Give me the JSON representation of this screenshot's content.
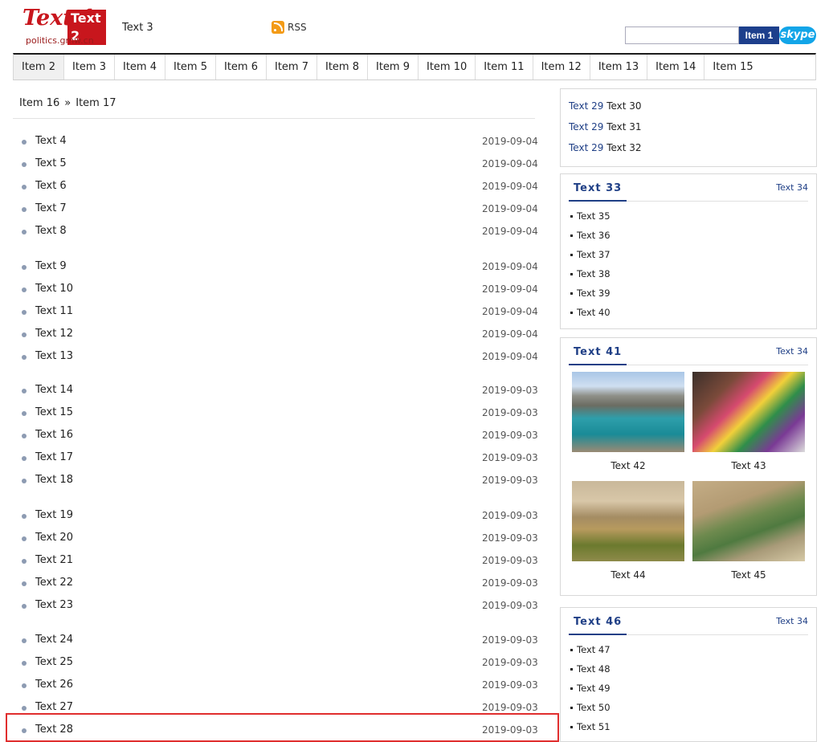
{
  "header": {
    "logo_script": "Text 1",
    "logo_badge": "Text 2",
    "logo_url": "politics.gmw.cn",
    "slogan": "Text 3",
    "rss_label": "RSS",
    "search_placeholder": "",
    "search_button": "Item 1",
    "skype_label": "skype"
  },
  "nav": {
    "items": [
      "Item 2",
      "Item 3",
      "Item 4",
      "Item 5",
      "Item 6",
      "Item 7",
      "Item 8",
      "Item 9",
      "Item 10",
      "Item 11",
      "Item 12",
      "Item 13",
      "Item 14",
      "Item 15"
    ]
  },
  "breadcrumb": {
    "root": "Item 16",
    "separator": "»",
    "current": "Item 17"
  },
  "news": [
    {
      "title": "Text 4",
      "date": "2019-09-04"
    },
    {
      "title": "Text 5",
      "date": "2019-09-04"
    },
    {
      "title": "Text 6",
      "date": "2019-09-04"
    },
    {
      "title": "Text 7",
      "date": "2019-09-04"
    },
    {
      "title": "Text 8",
      "date": "2019-09-04"
    },
    {
      "title": "Text 9",
      "date": "2019-09-04"
    },
    {
      "title": "Text 10",
      "date": "2019-09-04"
    },
    {
      "title": "Text 11",
      "date": "2019-09-04"
    },
    {
      "title": "Text 12",
      "date": "2019-09-04"
    },
    {
      "title": "Text 13",
      "date": "2019-09-04"
    },
    {
      "title": "Text 14",
      "date": "2019-09-03"
    },
    {
      "title": "Text 15",
      "date": "2019-09-03"
    },
    {
      "title": "Text 16",
      "date": "2019-09-03"
    },
    {
      "title": "Text 17",
      "date": "2019-09-03"
    },
    {
      "title": "Text 18",
      "date": "2019-09-03"
    },
    {
      "title": "Text 19",
      "date": "2019-09-03"
    },
    {
      "title": "Text 20",
      "date": "2019-09-03"
    },
    {
      "title": "Text 21",
      "date": "2019-09-03"
    },
    {
      "title": "Text 22",
      "date": "2019-09-03"
    },
    {
      "title": "Text 23",
      "date": "2019-09-03"
    },
    {
      "title": "Text 24",
      "date": "2019-09-03"
    },
    {
      "title": "Text 25",
      "date": "2019-09-03"
    },
    {
      "title": "Text 26",
      "date": "2019-09-03"
    },
    {
      "title": "Text 27",
      "date": "2019-09-03"
    },
    {
      "title": "Text 28",
      "date": "2019-09-03"
    }
  ],
  "editor_picks": [
    {
      "tag": "Text 29",
      "title": "Text 30"
    },
    {
      "tag": "Text 29",
      "title": "Text 31"
    },
    {
      "tag": "Text 29",
      "title": "Text 32"
    }
  ],
  "politics_news": {
    "title": "Text 33",
    "more": "Text 34",
    "items": [
      "Text 35",
      "Text 36",
      "Text 37",
      "Text 38",
      "Text 39",
      "Text 40"
    ]
  },
  "hot_pics": {
    "title": "Text 41",
    "more": "Text 34",
    "items": [
      {
        "caption": "Text 42",
        "image": "lake-image"
      },
      {
        "caption": "Text 43",
        "image": "people-image"
      },
      {
        "caption": "Text 44",
        "image": "field-image"
      },
      {
        "caption": "Text 45",
        "image": "terrace-image"
      }
    ]
  },
  "domestic_news": {
    "title": "Text 46",
    "more": "Text 34",
    "items": [
      "Text 47",
      "Text 48",
      "Text 49",
      "Text 50",
      "Text 51"
    ]
  },
  "colors": {
    "brand_red": "#c8161d",
    "link_blue": "#1f3f86",
    "highlight": "#e02e2e"
  }
}
